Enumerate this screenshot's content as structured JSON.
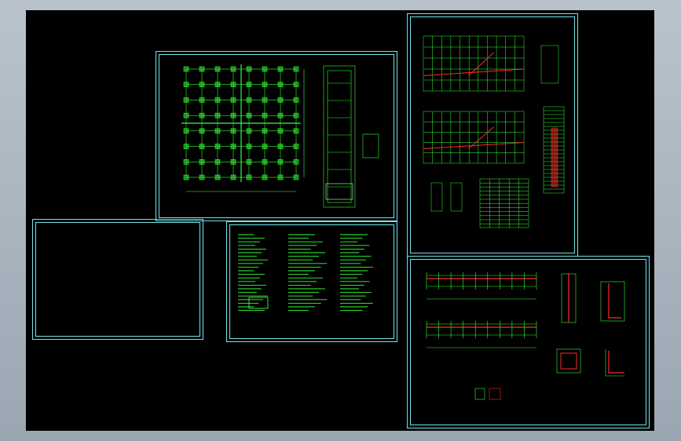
{
  "app": {
    "background_color": "#9aa6b2",
    "viewport_color": "#000000",
    "frame_color": "#6fe6ee",
    "line_color": "#33ff33",
    "accent_color": "#ff2a2a"
  },
  "sheets": [
    {
      "id": "foundation-plan-sheet"
    },
    {
      "id": "beam-plan-sheet"
    },
    {
      "id": "blank-sheet"
    },
    {
      "id": "design-notes-sheet"
    },
    {
      "id": "detail-sheet"
    }
  ]
}
